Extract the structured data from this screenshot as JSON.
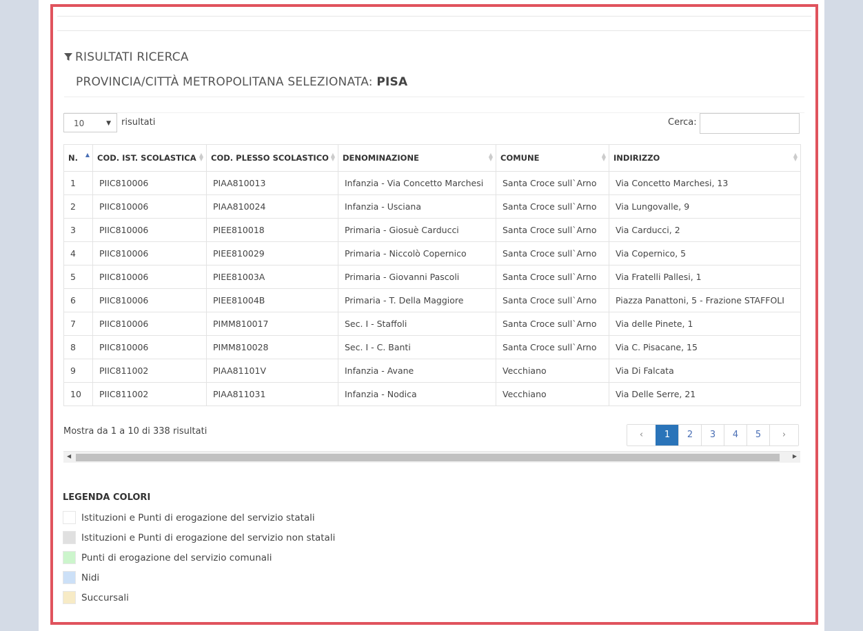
{
  "results": {
    "title": "RISULTATI RICERCA",
    "province_label": "PROVINCIA/CITTÀ METROPOLITANA SELEZIONATA:",
    "province_value": "PISA"
  },
  "controls": {
    "page_length": "10",
    "length_suffix": "risultati",
    "search_label": "Cerca:",
    "search_value": ""
  },
  "table": {
    "columns": [
      "N.",
      "COD. IST. SCOLASTICA",
      "COD. PLESSO SCOLASTICO",
      "DENOMINAZIONE",
      "COMUNE",
      "INDIRIZZO"
    ],
    "rows": [
      [
        "1",
        "PIIC810006",
        "PIAA810013",
        "Infanzia - Via Concetto Marchesi",
        "Santa Croce sull`Arno",
        "Via Concetto Marchesi, 13"
      ],
      [
        "2",
        "PIIC810006",
        "PIAA810024",
        "Infanzia - Usciana",
        "Santa Croce sull`Arno",
        "Via Lungovalle, 9"
      ],
      [
        "3",
        "PIIC810006",
        "PIEE810018",
        "Primaria - Giosuè Carducci",
        "Santa Croce sull`Arno",
        "Via Carducci, 2"
      ],
      [
        "4",
        "PIIC810006",
        "PIEE810029",
        "Primaria - Niccolò Copernico",
        "Santa Croce sull`Arno",
        "Via Copernico, 5"
      ],
      [
        "5",
        "PIIC810006",
        "PIEE81003A",
        "Primaria - Giovanni Pascoli",
        "Santa Croce sull`Arno",
        "Via Fratelli Pallesi, 1"
      ],
      [
        "6",
        "PIIC810006",
        "PIEE81004B",
        "Primaria - T. Della Maggiore",
        "Santa Croce sull`Arno",
        "Piazza Panattoni, 5 - Frazione STAFFOLI"
      ],
      [
        "7",
        "PIIC810006",
        "PIMM810017",
        "Sec. I - Staffoli",
        "Santa Croce sull`Arno",
        "Via delle Pinete, 1"
      ],
      [
        "8",
        "PIIC810006",
        "PIMM810028",
        "Sec. I - C. Banti",
        "Santa Croce sull`Arno",
        "Via C. Pisacane, 15"
      ],
      [
        "9",
        "PIIC811002",
        "PIAA81101V",
        "Infanzia - Avane",
        "Vecchiano",
        "Via Di Falcata"
      ],
      [
        "10",
        "PIIC811002",
        "PIAA811031",
        "Infanzia - Nodica",
        "Vecchiano",
        "Via Delle Serre, 21"
      ]
    ]
  },
  "info": "Mostra da 1 a 10 di 338 risultati",
  "pagination": {
    "prev": "‹",
    "pages": [
      "1",
      "2",
      "3",
      "4",
      "5"
    ],
    "next": "›",
    "active": "1"
  },
  "legend": {
    "title": "LEGENDA COLORI",
    "items": [
      {
        "label": "Istituzioni e Punti di erogazione del servizio statali",
        "color": "#ffffff"
      },
      {
        "label": "Istituzioni e Punti di erogazione del servizio non statali",
        "color": "#e0e0e0"
      },
      {
        "label": "Punti di erogazione del servizio comunali",
        "color": "#ccf5cc"
      },
      {
        "label": "Nidi",
        "color": "#cce0f7"
      },
      {
        "label": "Succursali",
        "color": "#f7ebc6"
      }
    ]
  }
}
